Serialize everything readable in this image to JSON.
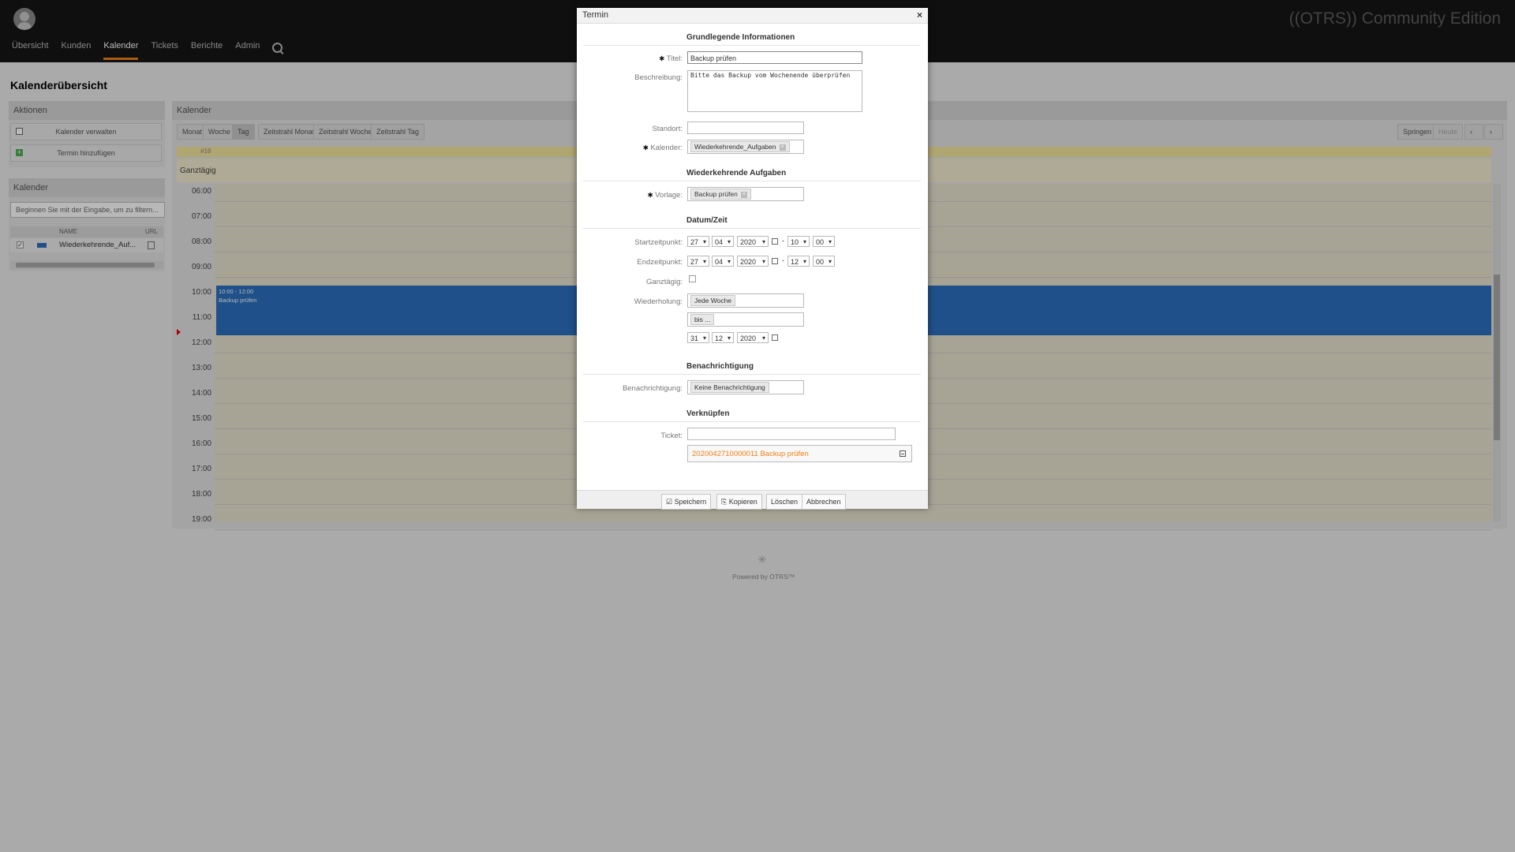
{
  "brand": {
    "prefix": "((OTRS))",
    "edition": "Community Edition"
  },
  "nav": [
    "Übersicht",
    "Kunden",
    "Kalender",
    "Tickets",
    "Berichte",
    "Admin"
  ],
  "page_title": "Kalenderübersicht",
  "actions": {
    "title": "Aktionen",
    "manage": "Kalender verwalten",
    "add": "Termin hinzufügen"
  },
  "calendars": {
    "title": "Kalender",
    "filter_placeholder": "Beginnen Sie mit der Eingabe, um zu filtern...",
    "col_name": "NAME",
    "col_url": "URL",
    "item": "Wiederkehrende_Auf...",
    "item_color": "#2c6fbf"
  },
  "calendar_view": {
    "title": "Kalender",
    "views": [
      "Monat",
      "Woche",
      "Tag",
      "Zeitstrahl Monat",
      "Zeitstrahl Woche",
      "Zeitstrahl Tag"
    ],
    "active_view": "Tag",
    "jump": "Springen",
    "today": "Heute",
    "week_label": "#18",
    "allday_label": "Ganztägig",
    "hours": [
      "06:00",
      "07:00",
      "08:00",
      "09:00",
      "10:00",
      "11:00",
      "12:00",
      "13:00",
      "14:00",
      "15:00",
      "16:00",
      "17:00",
      "18:00",
      "19:00"
    ],
    "event": {
      "time": "10:00 - 12:00",
      "title": "Backup prüfen",
      "color": "#2c6fbf"
    }
  },
  "footer": {
    "powered": "Powered by OTRS™"
  },
  "modal": {
    "title": "Termin",
    "sections": {
      "basic": "Grundlegende Informationen",
      "recurring": "Wiederkehrende Aufgaben",
      "datetime": "Datum/Zeit",
      "notification": "Benachrichtigung",
      "link": "Verknüpfen"
    },
    "labels": {
      "title": "Titel:",
      "description": "Beschreibung:",
      "location": "Standort:",
      "calendar": "Kalender:",
      "template": "Vorlage:",
      "start": "Startzeitpunkt:",
      "end": "Endzeitpunkt:",
      "allday": "Ganztägig:",
      "repeat": "Wiederholung:",
      "notification": "Benachrichtigung:",
      "ticket": "Ticket:"
    },
    "values": {
      "title": "Backup prüfen",
      "description": "Bitte das Backup vom Wochenende überprüfen",
      "location": "",
      "calendar": "Wiederkehrende_Aufgaben",
      "template": "Backup prüfen",
      "start": {
        "day": "27",
        "month": "04",
        "year": "2020",
        "hour": "10",
        "minute": "00"
      },
      "end": {
        "day": "27",
        "month": "04",
        "year": "2020",
        "hour": "12",
        "minute": "00"
      },
      "repeat": "Jede Woche",
      "repeat_until": "bis ...",
      "until": {
        "day": "31",
        "month": "12",
        "year": "2020"
      },
      "notification": "Keine Benachrichtigung",
      "ticket": "",
      "linked_ticket": "2020042710000011 Backup prüfen"
    },
    "buttons": {
      "save": "Speichern",
      "copy": "Kopieren",
      "delete": "Löschen",
      "cancel": "Abbrechen"
    }
  }
}
